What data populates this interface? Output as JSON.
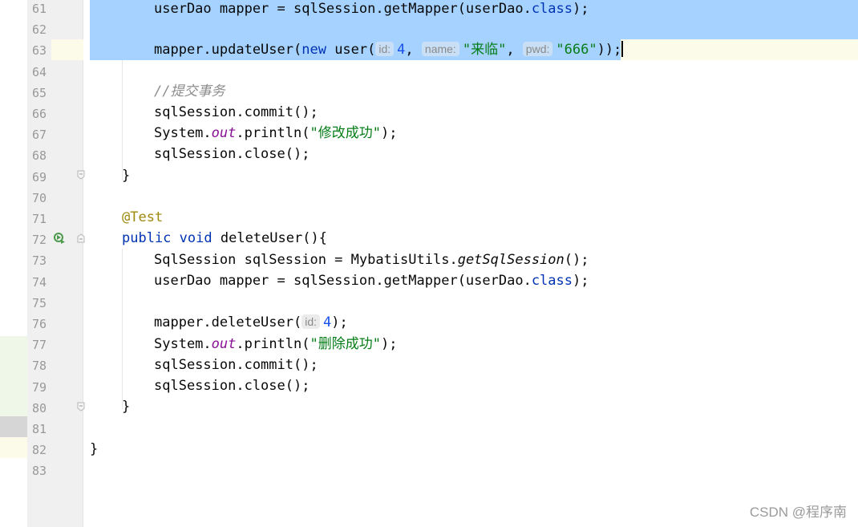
{
  "editor": {
    "lines": [
      {
        "n": "61"
      },
      {
        "n": "62"
      },
      {
        "n": "63"
      },
      {
        "n": "64"
      },
      {
        "n": "65"
      },
      {
        "n": "66"
      },
      {
        "n": "67"
      },
      {
        "n": "68"
      },
      {
        "n": "69"
      },
      {
        "n": "70"
      },
      {
        "n": "71"
      },
      {
        "n": "72"
      },
      {
        "n": "73"
      },
      {
        "n": "74"
      },
      {
        "n": "75"
      },
      {
        "n": "76"
      },
      {
        "n": "77"
      },
      {
        "n": "78"
      },
      {
        "n": "79"
      },
      {
        "n": "80"
      },
      {
        "n": "81"
      },
      {
        "n": "82"
      },
      {
        "n": "83"
      }
    ],
    "code": {
      "l61": {
        "a": "userDao mapper = sqlSession.getMapper(userDao.",
        "kw": "class",
        "b": ");"
      },
      "l63": {
        "a": "mapper.updateUser(",
        "kw": "new",
        "b": " user(",
        "h1": "id:",
        "num": "4",
        "c": ", ",
        "h2": "name:",
        "s1": "\"来临\"",
        "d": ", ",
        "h3": "pwd:",
        "s2": "\"666\"",
        "e": "));"
      },
      "l65": {
        "cmt": "//提交事务"
      },
      "l66": {
        "a": "sqlSession.commit();"
      },
      "l67": {
        "a": "System.",
        "fld": "out",
        "b": ".println(",
        "str": "\"修改成功\"",
        "c": ");"
      },
      "l68": {
        "a": "sqlSession.close();"
      },
      "l69": {
        "a": "}"
      },
      "l71": {
        "ann": "@Test"
      },
      "l72": {
        "kw1": "public",
        "sp": " ",
        "kw2": "void",
        "b": " deleteUser(){",
        "name": "deleteUser"
      },
      "l73": {
        "a": "SqlSession sqlSession = MybatisUtils.",
        "it": "getSqlSession",
        "b": "();"
      },
      "l74": {
        "a": "userDao mapper = sqlSession.getMapper(userDao.",
        "kw": "class",
        "b": ");"
      },
      "l76": {
        "a": "mapper.deleteUser(",
        "h1": "id:",
        "num": "4",
        "b": ");"
      },
      "l77": {
        "a": "System.",
        "fld": "out",
        "b": ".println(",
        "str": "\"删除成功\"",
        "c": ");"
      },
      "l78": {
        "a": "sqlSession.commit();"
      },
      "l79": {
        "a": "sqlSession.close();"
      },
      "l80": {
        "a": "}"
      },
      "l82": {
        "a": "}"
      }
    }
  },
  "watermark": "CSDN @程序南",
  "colors": {
    "selection": "#a6d2ff",
    "keyword": "#0033b3",
    "string": "#067d17",
    "number": "#1750eb",
    "annotation": "#9e880d",
    "field": "#871094",
    "comment": "#8c8c8c"
  }
}
